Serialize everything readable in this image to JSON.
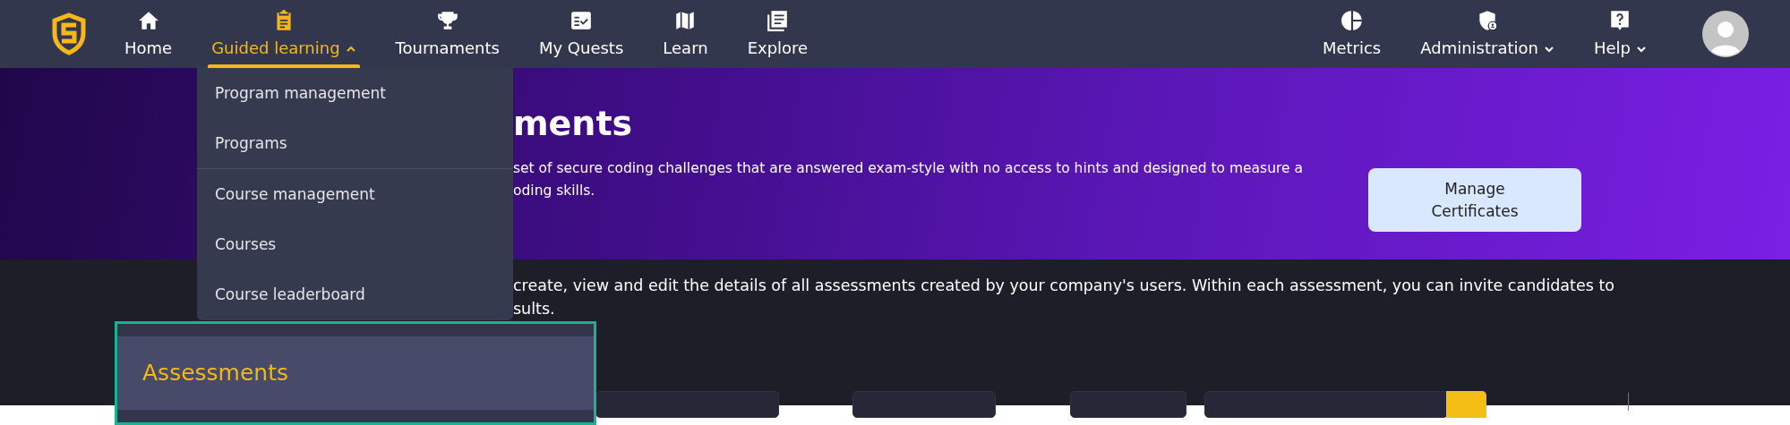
{
  "nav": {
    "left": [
      {
        "label": "Home",
        "kind": "link",
        "selected": false
      },
      {
        "label": "Guided learning",
        "kind": "dropdown",
        "expanded": true,
        "selected": true
      },
      {
        "label": "Tournaments",
        "kind": "link",
        "selected": false
      },
      {
        "label": "My Quests",
        "kind": "link",
        "selected": false
      },
      {
        "label": "Learn",
        "kind": "link",
        "selected": false
      },
      {
        "label": "Explore",
        "kind": "link",
        "selected": false
      }
    ],
    "right": [
      {
        "label": "Metrics",
        "kind": "link",
        "selected": false
      },
      {
        "label": "Administration",
        "kind": "dropdown",
        "expanded": false,
        "selected": false
      },
      {
        "label": "Help",
        "kind": "dropdown",
        "expanded": false,
        "selected": false
      }
    ]
  },
  "dropdown": {
    "items": [
      {
        "label": "Program management",
        "divider_before": false
      },
      {
        "label": "Programs",
        "divider_before": false
      },
      {
        "label": "Course management",
        "divider_before": true
      },
      {
        "label": "Courses",
        "divider_before": false
      },
      {
        "label": "Course leaderboard",
        "divider_before": false
      }
    ]
  },
  "banner": {
    "title": "ments",
    "description": [
      "set of secure coding challenges that are answered exam-style with no access to hints and designed to measure a",
      "oding skills."
    ],
    "button": "Manage Certificates"
  },
  "intro": [
    "create, view and edit the details of all assessments created by your company's users. Within each assessment, you can invite candidates to",
    "sults."
  ],
  "callout": {
    "label": "Assessments"
  }
}
